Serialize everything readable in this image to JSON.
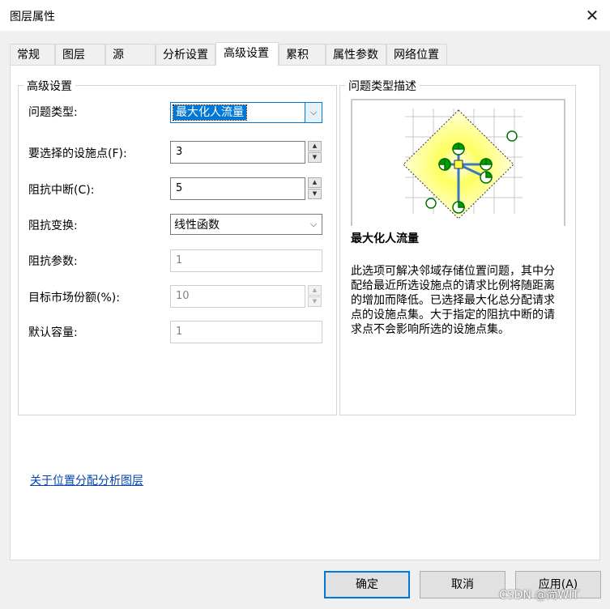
{
  "window": {
    "title": "图层属性",
    "close_glyph": "✕"
  },
  "tabs": [
    {
      "label": "常规"
    },
    {
      "label": "图层"
    },
    {
      "label": "源"
    },
    {
      "label": "分析设置"
    },
    {
      "label": "高级设置"
    },
    {
      "label": "累积"
    },
    {
      "label": "属性参数"
    },
    {
      "label": "网络位置"
    }
  ],
  "active_tab": "高级设置",
  "advanced": {
    "group_title": "高级设置",
    "problem_type": {
      "label": "问题类型:",
      "value": "最大化人流量"
    },
    "facilities": {
      "label": "要选择的设施点(F):",
      "value": "3"
    },
    "cutoff": {
      "label": "阻抗中断(C):",
      "value": "5"
    },
    "transform": {
      "label": "阻抗变换:",
      "value": "线性函数"
    },
    "param": {
      "label": "阻抗参数:",
      "value": "1"
    },
    "market_share": {
      "label": "目标市场份额(%):",
      "value": "10"
    },
    "capacity": {
      "label": "默认容量:",
      "value": "1"
    }
  },
  "description": {
    "group_title": "问题类型描述",
    "title": "最大化人流量",
    "text": "此选项可解决邻域存储位置问题，其中分配给最近所选设施点的请求比例将随距离的增加而降低。已选择最大化总分配请求点的设施点集。大于指定的阻抗中断的请求点不会影响所选的设施点集。"
  },
  "link": {
    "text": "关于位置分配分析图层"
  },
  "buttons": {
    "ok": "确定",
    "cancel": "取消",
    "apply": "应用(A)"
  },
  "watermark": "CSDN @简WIT",
  "icons": {
    "spin_up": "▲",
    "spin_down": "▼",
    "dropdown": "⌵"
  },
  "colors": {
    "accent": "#0078d7",
    "link": "#0645ad",
    "diamond": "#ffff80",
    "facility": "#00a000"
  }
}
